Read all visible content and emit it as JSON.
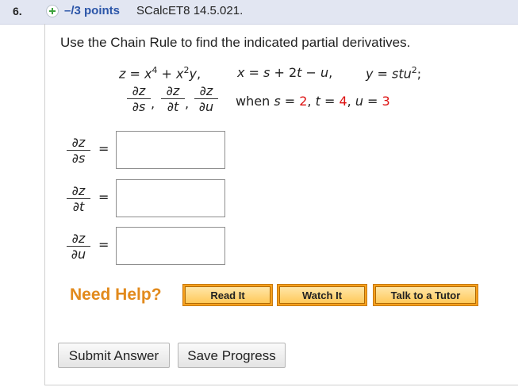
{
  "header": {
    "question_number": "6.",
    "points": "–/3 points",
    "source": "SCalcET8 14.5.021."
  },
  "question": {
    "instruction": "Use the Chain Rule to find the indicated partial derivatives.",
    "z_equation": "z = x⁴ + x²y,",
    "x_equation": "x = s + 2t − u,",
    "y_equation": "y = stu²;",
    "derivatives": [
      {
        "num": "∂z",
        "den": "∂s"
      },
      {
        "num": "∂z",
        "den": "∂t"
      },
      {
        "num": "∂z",
        "den": "∂u"
      }
    ],
    "when_label": "when",
    "s_label": "s =",
    "s_value": "2",
    "t_label": "t =",
    "t_value": "4",
    "u_label": "u =",
    "u_value": "3"
  },
  "answers": [
    {
      "num": "∂z",
      "den": "∂s",
      "equals": "=",
      "value": ""
    },
    {
      "num": "∂z",
      "den": "∂t",
      "equals": "=",
      "value": ""
    },
    {
      "num": "∂z",
      "den": "∂u",
      "equals": "=",
      "value": ""
    }
  ],
  "help": {
    "label": "Need Help?",
    "read_it": "Read It",
    "watch_it": "Watch It",
    "talk_tutor": "Talk to a Tutor"
  },
  "footer": {
    "submit": "Submit Answer",
    "save": "Save Progress"
  },
  "colors": {
    "header_bg": "#e2e6f2",
    "points_blue": "#2b55a8",
    "value_red": "#dd1111",
    "help_orange": "#e28a1c",
    "button_orange": "#f7a01d"
  }
}
